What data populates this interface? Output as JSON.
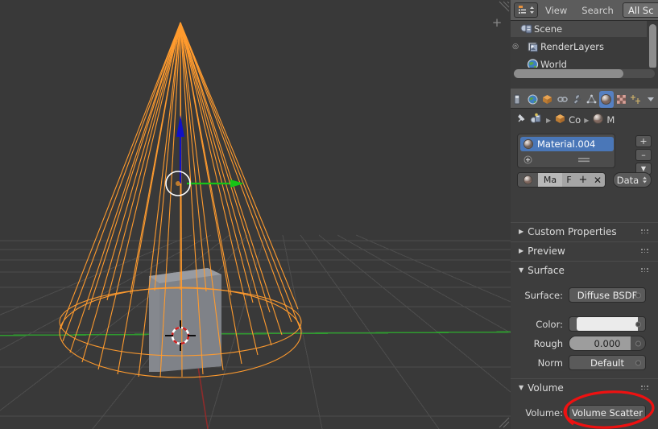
{
  "app": {
    "name": "Blender",
    "theme": "dark"
  },
  "viewport": {
    "name": "3d-viewport",
    "background_color": "#393939",
    "grid_color": "#4f4f4f",
    "axis_y_color": "#3f9c35",
    "axis_x_color": "#9c3535",
    "objects": [
      {
        "name": "Cone",
        "state": "selected",
        "wire_color": "#ff9f33",
        "display": "wireframe"
      },
      {
        "name": "Cube",
        "state": "unselected",
        "color": "#8a8d93",
        "display": "solid"
      }
    ],
    "manipulator": {
      "type": "translate",
      "z_axis_color": "#1414d2",
      "y_axis_color": "#1ec81e",
      "ring_color": "#ffffff"
    },
    "cursor_3d": {
      "name": "3d-cursor",
      "colors": [
        "#ffffff",
        "#cc2222",
        "#000000"
      ]
    },
    "add_tab_label": "+"
  },
  "outliner": {
    "header": {
      "editor_type": "outliner-editor",
      "menus": [
        "View",
        "Search"
      ],
      "display_mode": "All Sc"
    },
    "rows": [
      {
        "label": "Scene",
        "icon": "scene-icon",
        "indent": 0,
        "selected": true,
        "expandable": false
      },
      {
        "label": "RenderLayers",
        "icon": "renderlayers-icon",
        "indent": 1,
        "selected": false,
        "expandable": true
      },
      {
        "label": "World",
        "icon": "world-icon",
        "indent": 1,
        "selected": false,
        "expandable": false
      }
    ]
  },
  "properties": {
    "tabs": [
      {
        "name": "render-tab",
        "icon": "camera-back-icon",
        "active": false
      },
      {
        "name": "scene-world-tab",
        "icon": "world-icon",
        "active": false
      },
      {
        "name": "object-tab",
        "icon": "cube-icon",
        "active": false
      },
      {
        "name": "constraints-tab",
        "icon": "chain-icon",
        "active": false
      },
      {
        "name": "modifiers-tab",
        "icon": "wrench-icon",
        "active": false
      },
      {
        "name": "data-tab",
        "icon": "mesh-data-icon",
        "active": false
      },
      {
        "name": "material-tab",
        "icon": "material-sphere-icon",
        "active": true
      },
      {
        "name": "texture-tab",
        "icon": "checker-icon",
        "active": false
      },
      {
        "name": "particles-tab",
        "icon": "particles-icon",
        "active": false
      }
    ],
    "breadcrumb": [
      {
        "name": "pin-icon",
        "label": ""
      },
      {
        "name": "scene-icon",
        "label": ""
      },
      {
        "name": "object-icon",
        "label": "Co"
      },
      {
        "name": "material-icon",
        "label": "M"
      }
    ],
    "material_slots": {
      "selected_slot": "Material.004",
      "slot_icon": "material-sphere-icon",
      "add_slot_label": "+",
      "remove_slot_label": "–",
      "menu_label": "▼"
    },
    "material_datablock": {
      "browse_icon": "material-sphere-icon",
      "name_value": "Ma",
      "fake_user_label": "F",
      "new_label": "+",
      "unlink_label": "✕",
      "type_value": "Data"
    },
    "panels": [
      {
        "name": "custom-properties-panel",
        "title": "Custom Properties",
        "open": false
      },
      {
        "name": "preview-panel",
        "title": "Preview",
        "open": false
      },
      {
        "name": "surface-panel",
        "title": "Surface",
        "open": true
      },
      {
        "name": "volume-panel",
        "title": "Volume",
        "open": true
      }
    ],
    "surface": {
      "surface_label": "Surface:",
      "surface_value": "Diffuse BSDF",
      "color_label": "Color:",
      "color_value": "#ebebeb",
      "rough_label": "Rough",
      "rough_value": "0.000",
      "norm_label": "Norm",
      "norm_value": "Default"
    },
    "volume": {
      "volume_label": "Volume:",
      "volume_value": "Volume Scatter"
    }
  },
  "annotation": {
    "name": "red-circle-highlight",
    "target": "Volume Scatter",
    "color": "#ee1111"
  }
}
